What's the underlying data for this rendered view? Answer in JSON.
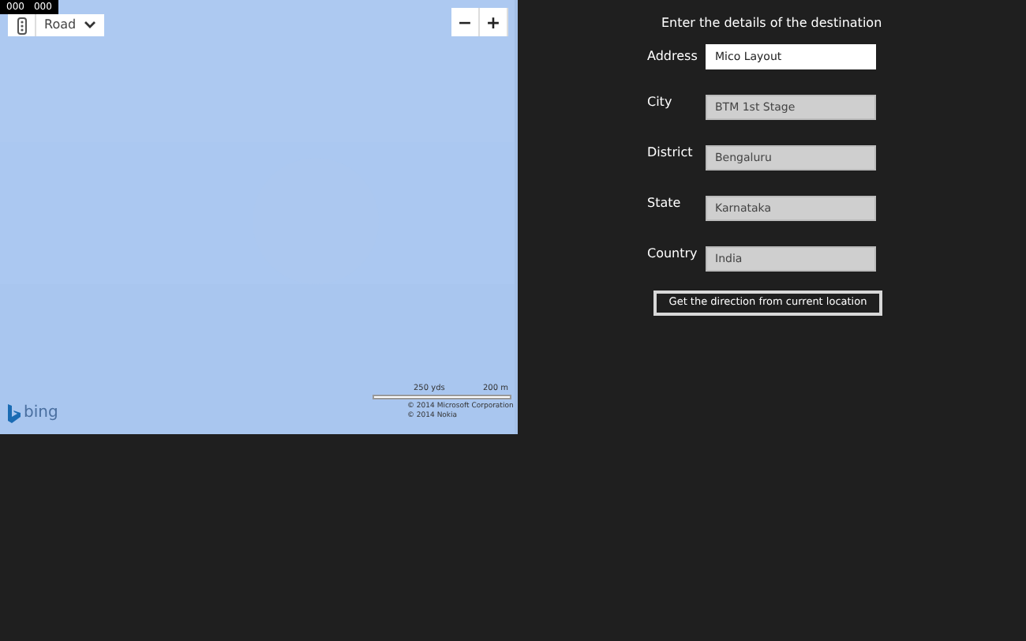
{
  "debug_counters": [
    "000",
    "000"
  ],
  "map": {
    "style_selector": {
      "value": "Road"
    },
    "zoom_buttons": [
      "−",
      "+"
    ],
    "scale": {
      "imperial": "250 yds",
      "metric": "200 m"
    },
    "copyright": [
      "© 2014 Microsoft Corporation",
      "© 2014 Nokia"
    ],
    "logo": "bing"
  },
  "form": {
    "heading": "Enter the details of the destination",
    "fields": [
      {
        "label": "Address",
        "value": "Mico Layout",
        "disabled": false
      },
      {
        "label": "City",
        "value": "BTM 1st Stage",
        "disabled": true
      },
      {
        "label": "District",
        "value": "Bengaluru",
        "disabled": true
      },
      {
        "label": "State",
        "value": "Karnataka",
        "disabled": true
      },
      {
        "label": "Country",
        "value": "India",
        "disabled": true
      }
    ],
    "button": "Get the direction from current location"
  }
}
